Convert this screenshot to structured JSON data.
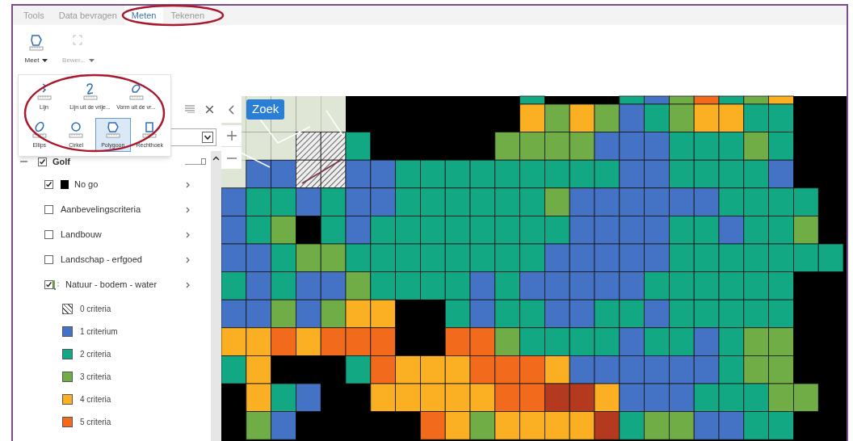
{
  "tabs": [
    {
      "label": "Tools",
      "selected": false
    },
    {
      "label": "Data bevragen",
      "selected": false
    },
    {
      "label": "Meten",
      "selected": true
    },
    {
      "label": "Tekenen",
      "selected": false
    }
  ],
  "ribbon": {
    "buttons": [
      {
        "label": "Meet",
        "disabled": false
      },
      {
        "label": "Bewer...",
        "disabled": true
      }
    ]
  },
  "measure_menu": {
    "rows": [
      {
        "items": [
          {
            "label": "Lijn",
            "selected": false
          },
          {
            "label": "Lijn uit de vrije...",
            "selected": false
          },
          {
            "label": "Vorm uit de vr...",
            "selected": false
          }
        ]
      },
      {
        "items": [
          {
            "label": "Ellips",
            "selected": false
          },
          {
            "label": "Cirkel",
            "selected": false
          },
          {
            "label": "Polygoon",
            "selected": true
          },
          {
            "label": "Rechthoek",
            "selected": false
          }
        ]
      }
    ]
  },
  "layer_panel": {
    "layers": [
      {
        "label": "Golf",
        "checked": true,
        "expanded": true,
        "level": 1,
        "children": [
          {
            "label": "No go",
            "checked": true,
            "color": "#000000"
          },
          {
            "label": "Aanbevelingscriteria",
            "checked": false
          },
          {
            "label": "Landbouw",
            "checked": false
          },
          {
            "label": "Landschap - erfgoed",
            "checked": false
          },
          {
            "label": "Natuur - bodem - water",
            "checked": true,
            "legend": [
              {
                "label": "0 criteria",
                "kind": "hatch"
              },
              {
                "label": "1 criterium",
                "kind": "swatch",
                "color": "#4472c4"
              },
              {
                "label": "2 criteria",
                "kind": "swatch",
                "color": "#13a884"
              },
              {
                "label": "3 criteria",
                "kind": "swatch",
                "color": "#70ad47"
              },
              {
                "label": "4 criteria",
                "kind": "swatch",
                "color": "#fbb024"
              },
              {
                "label": "5 criteria",
                "kind": "swatch",
                "color": "#f26b1d"
              }
            ]
          }
        ]
      }
    ]
  },
  "map": {
    "search_button": "Zoek"
  }
}
